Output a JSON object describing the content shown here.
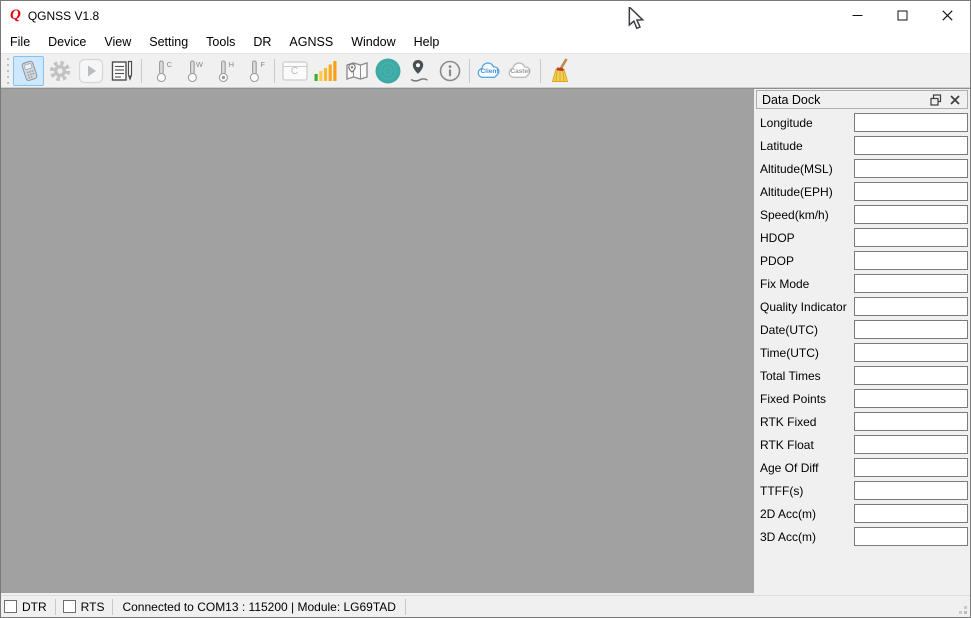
{
  "window": {
    "title": "QGNSS V1.8",
    "logo_glyph": "Q"
  },
  "menu": {
    "items": [
      "File",
      "Device",
      "View",
      "Setting",
      "Tools",
      "DR",
      "AGNSS",
      "Window",
      "Help"
    ]
  },
  "toolbar": {
    "thermometer_letters": {
      "cold": "C",
      "warm": "W",
      "hot": "H",
      "factory": "F"
    },
    "console_letter": "C",
    "client_label": "Client",
    "caster_label": "Caster"
  },
  "colors": {
    "selected_button_bg": "#cde8ff",
    "selected_button_border": "#84c3f0",
    "workspace_gray": "#a1a1a1",
    "skyview_teal": "#3fa9a4",
    "signal_green": "#4caf50",
    "signal_orange": "#f9b234",
    "logo_red": "#e60012"
  },
  "data_dock": {
    "title": "Data Dock",
    "fields": [
      {
        "label": "Longitude",
        "value": ""
      },
      {
        "label": "Latitude",
        "value": ""
      },
      {
        "label": "Altitude(MSL)",
        "value": ""
      },
      {
        "label": "Altitude(EPH)",
        "value": ""
      },
      {
        "label": "Speed(km/h)",
        "value": ""
      },
      {
        "label": "HDOP",
        "value": ""
      },
      {
        "label": "PDOP",
        "value": ""
      },
      {
        "label": "Fix Mode",
        "value": ""
      },
      {
        "label": "Quality Indicator",
        "value": ""
      },
      {
        "label": "Date(UTC)",
        "value": ""
      },
      {
        "label": "Time(UTC)",
        "value": ""
      },
      {
        "label": "Total Times",
        "value": ""
      },
      {
        "label": "Fixed Points",
        "value": ""
      },
      {
        "label": "RTK Fixed",
        "value": ""
      },
      {
        "label": "RTK Float",
        "value": ""
      },
      {
        "label": "Age Of Diff",
        "value": ""
      },
      {
        "label": "TTFF(s)",
        "value": ""
      },
      {
        "label": "2D Acc(m)",
        "value": ""
      },
      {
        "label": "3D Acc(m)",
        "value": ""
      }
    ]
  },
  "status_bar": {
    "dtr_label": "DTR",
    "rts_label": "RTS",
    "dtr_checked": false,
    "rts_checked": false,
    "message": "Connected to COM13 : 115200 | Module: LG69TAD"
  }
}
